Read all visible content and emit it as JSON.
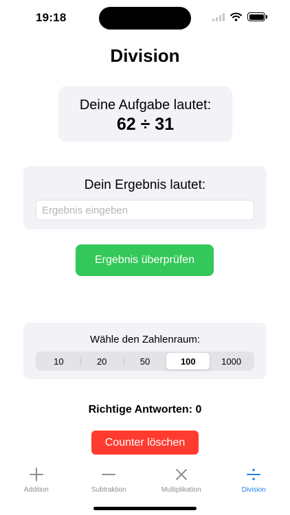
{
  "status_bar": {
    "time": "19:18"
  },
  "title": "Division",
  "task": {
    "label": "Deine Aufgabe lautet:",
    "expression": "62 ÷ 31"
  },
  "result": {
    "label": "Dein Ergebnis lautet:",
    "value": "",
    "placeholder": "Ergebnis eingeben"
  },
  "check_button": {
    "label": "Ergebnis überprüfen"
  },
  "range": {
    "label": "Wähle den Zahlenraum:",
    "options": [
      "10",
      "20",
      "50",
      "100",
      "1000"
    ],
    "selected": "100"
  },
  "counter": {
    "text": "Richtige Antworten: 0"
  },
  "reset_button": {
    "label": "Counter löschen"
  },
  "tabs": [
    {
      "label": "Addition",
      "icon": "plus-icon",
      "active": false
    },
    {
      "label": "Subtraktion",
      "icon": "minus-icon",
      "active": false
    },
    {
      "label": "Multiplikation",
      "icon": "multiply-icon",
      "active": false
    },
    {
      "label": "Division",
      "icon": "divide-icon",
      "active": true
    }
  ],
  "colors": {
    "accent": "#1f7ff2",
    "check_button": "#34c759",
    "reset_button": "#ff3b30",
    "card_background": "#f2f2f7"
  }
}
